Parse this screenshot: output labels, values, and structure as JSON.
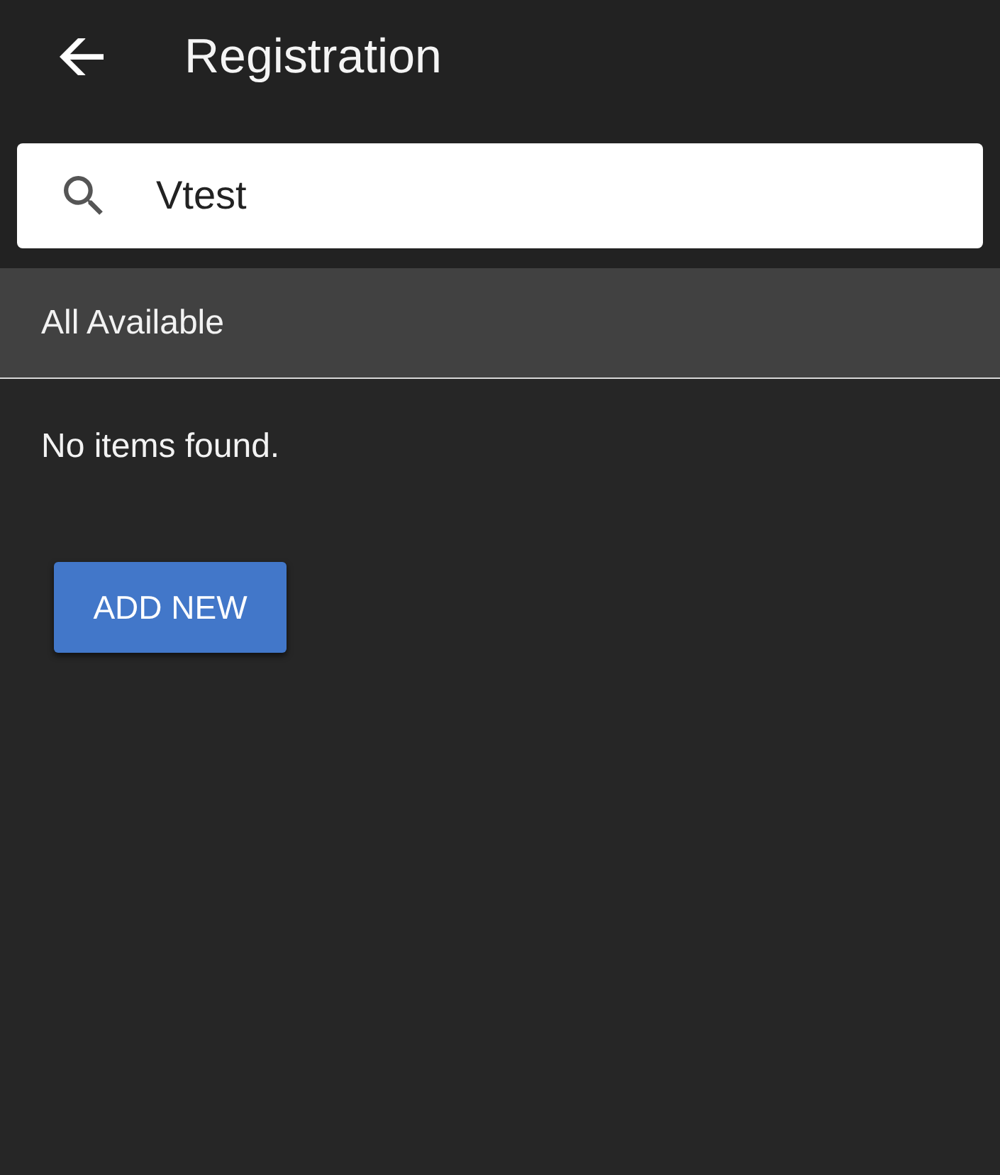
{
  "header": {
    "title": "Registration"
  },
  "search": {
    "value": "Vtest"
  },
  "section": {
    "title": "All Available"
  },
  "empty_message": "No items found.",
  "buttons": [
    {
      "label": "ADD NEW"
    }
  ]
}
